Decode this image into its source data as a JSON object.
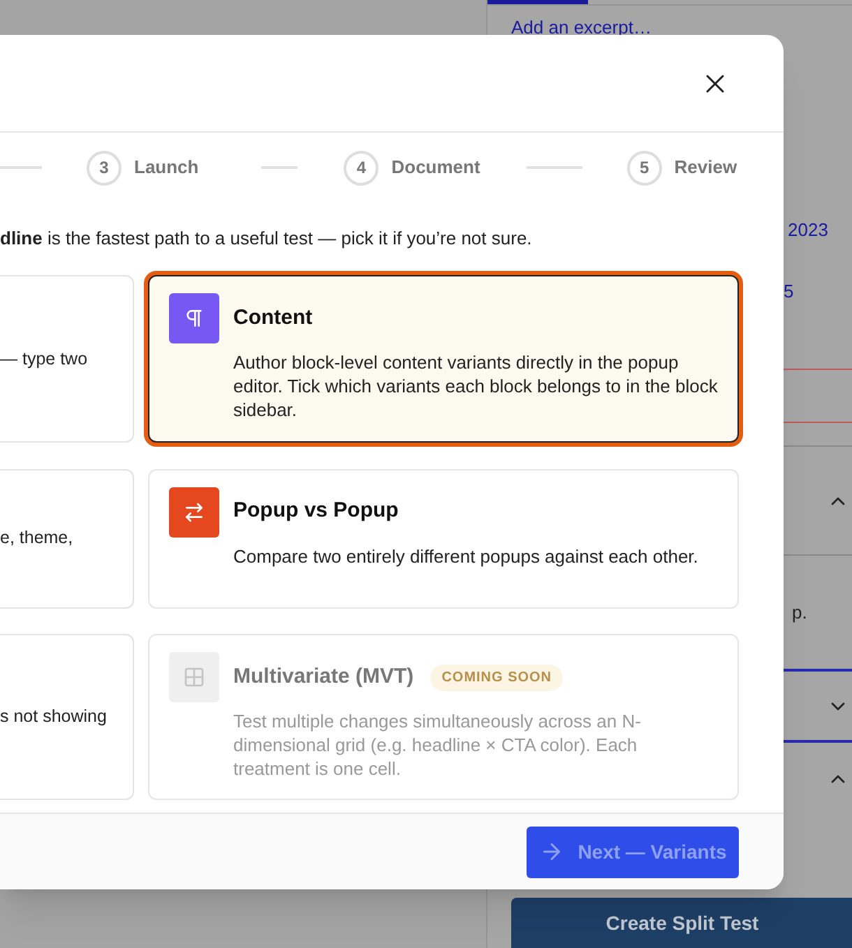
{
  "background": {
    "excerpt_link": "Add an excerpt…",
    "date_fragment": "2023",
    "number_fragment": "5",
    "text_fragment": "p.",
    "panels": [
      {
        "expanded": true
      },
      {
        "expanded": false
      },
      {
        "expanded": true
      }
    ],
    "create_button": "Create Split Test"
  },
  "dialog": {
    "steps": [
      {
        "number": "3",
        "label": "Launch"
      },
      {
        "number": "4",
        "label": "Document"
      },
      {
        "number": "5",
        "label": "Review"
      }
    ],
    "intro": "**dline** is the fastest path to a useful test — pick it if you’re not sure.",
    "left_options": [
      {
        "description": "— type two",
        "selected": false
      },
      {
        "description": "e, theme,",
        "selected": false
      },
      {
        "description": "s not showing",
        "selected": false
      }
    ],
    "options": [
      {
        "title": "Content",
        "description": "Author block-level content variants directly in the popup editor. Tick which variants each block belongs to in the block sidebar.",
        "selected": true,
        "disabled": false,
        "color": "#7758f2"
      },
      {
        "title": "Popup vs Popup",
        "description": "Compare two entirely different popups against each other.",
        "selected": false,
        "disabled": false,
        "color": "#e5471f"
      },
      {
        "title": "Multivariate (MVT)",
        "badge": "COMING SOON",
        "description": "Test multiple changes simultaneously across an N-dimensional grid (e.g. headline × CTA color). Each treatment is one cell.",
        "selected": false,
        "disabled": true,
        "color": "#efefef"
      }
    ],
    "next_button": {
      "label": "Next — Variants",
      "disabled": true
    }
  }
}
